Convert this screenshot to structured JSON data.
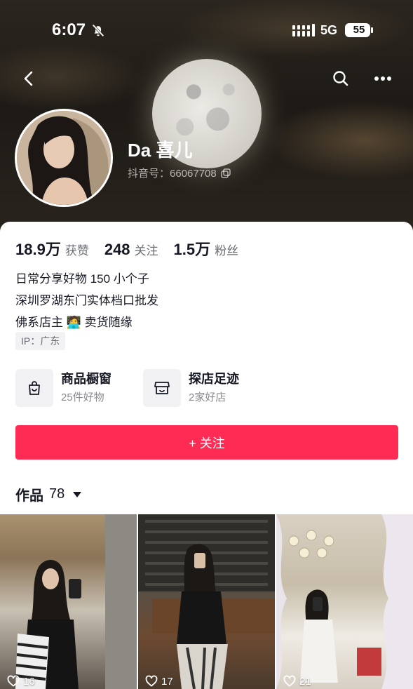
{
  "status_bar": {
    "time": "6:07",
    "network": "5G",
    "battery": "55"
  },
  "profile": {
    "nickname": "Da 喜儿",
    "douyin_id": "抖音号：66067708",
    "stats": [
      {
        "value": "18.9万",
        "label": "获赞"
      },
      {
        "value": "248",
        "label": "关注"
      },
      {
        "value": "1.5万",
        "label": "粉丝"
      }
    ],
    "bio": {
      "line1": "日常分享好物 150 小个子",
      "line2": "深圳罗湖东门实体档口批发",
      "line3_text": "佛系店主",
      "line3_emoji": "🧑‍💻",
      "line3_tail": "卖货随缘"
    },
    "ip": "IP：广东"
  },
  "entries": {
    "shop": {
      "title": "商品橱窗",
      "subtitle": "25件好物",
      "icon": "shopping-bag-icon"
    },
    "visit": {
      "title": "探店足迹",
      "subtitle": "2家好店",
      "icon": "storefront-icon"
    }
  },
  "follow_button": "+ 关注",
  "works": {
    "label": "作品",
    "count": "78",
    "items": [
      {
        "likes": "16"
      },
      {
        "likes": "17"
      },
      {
        "likes": "21"
      }
    ]
  },
  "colors": {
    "accent": "#fe2c55",
    "text_primary": "#161823",
    "text_secondary": "#6b6d75"
  }
}
